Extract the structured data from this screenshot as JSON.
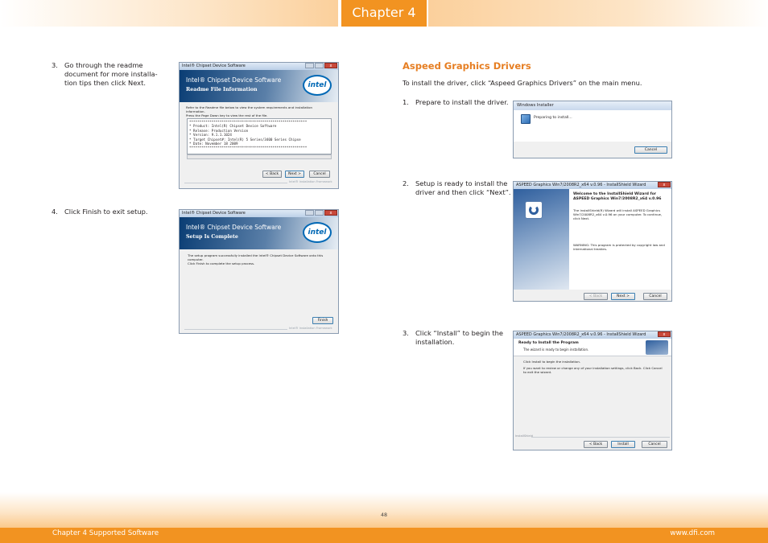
{
  "header": {
    "chapter_tab": "Chapter 4"
  },
  "left": {
    "steps": [
      {
        "num": "3.",
        "text": "Go through the readme document for more installation tips then click Next."
      },
      {
        "num": "4.",
        "text": "Click Finish to exit setup."
      }
    ],
    "step3_lines": [
      "Go through the readme",
      "document for more installa-",
      "tion tips then click Next."
    ],
    "readme_window": {
      "title": "Intel® Chipset Device Software",
      "banner_title": "Intel® Chipset Device Software",
      "banner_sub": "Readme File Information",
      "instruction_1": "Refer to the Readme file below to view the system requirements and installation information.",
      "instruction_2": "Press the Page Down key to view the rest of the file.",
      "readme_lines": [
        "**********************************************************",
        "*  Product: Intel(R) Chipset Device Software",
        "*  Release: Production Version",
        "*  Version: 9.1.1.1024",
        "*  Target Chipset#: Intel(R) 5 Series/3400 Series Chipse",
        "*  Date: November 18 2009",
        "**********************************************************"
      ],
      "btn_back": "< Back",
      "btn_next": "Next >",
      "btn_cancel": "Cancel",
      "footer": "Intel® Installation Framework",
      "close_glyph": "x"
    },
    "complete_window": {
      "title": "Intel® Chipset Device Software",
      "banner_title": "Intel® Chipset Device Software",
      "banner_sub": "Setup Is Complete",
      "message_1": "The setup program successfully installed the Intel® Chipset Device Software onto this computer.",
      "message_2": "Click Finish to complete the setup process.",
      "btn_finish": "Finish",
      "footer": "Intel® Installation Framework",
      "close_glyph": "x"
    },
    "intel_logo": "intel"
  },
  "right": {
    "heading": "Aspeed Graphics Drivers",
    "intro": "To install the driver, click “Aspeed Graphics Drivers” on the main menu.",
    "step1": {
      "num": "1.",
      "text": "Prepare to install the driver."
    },
    "step2": {
      "num": "2.",
      "lines": [
        "Setup is ready to install the",
        "driver and then click “Next”."
      ]
    },
    "step3": {
      "num": "3.",
      "lines": [
        "Click “Install” to begin the",
        "installation."
      ]
    },
    "installer_window": {
      "title": "Windows Installer",
      "message": "Preparing to install...",
      "btn_cancel": "Cancel"
    },
    "wizard_window": {
      "title": "ASPEED Graphics Win7/2008R2_x64 v.0.96 - InstallShield Wizard",
      "welcome_line1": "Welcome to the InstallShield Wizard for",
      "welcome_line2": "ASPEED Graphics Win7/2008R2_x64 v.0.96",
      "desc": "The InstallShield(R) Wizard will install ASPEED Graphics Win7/2008R2_x64 v.0.96 on your computer. To continue, click Next.",
      "warning": "WARNING: This program is protected by copyright law and international treaties.",
      "btn_back": "< Back",
      "btn_next": "Next >",
      "btn_cancel": "Cancel",
      "close_glyph": "x"
    },
    "ready_window": {
      "title": "ASPEED Graphics Win7/2008R2_x64 v.0.96 - InstallShield Wizard",
      "heading": "Ready to Install the Program",
      "subheading": "The wizard is ready to begin installation.",
      "line1": "Click Install to begin the installation.",
      "line2": "If you want to review or change any of your installation settings, click Back. Click Cancel to exit the wizard.",
      "installshield": "InstallShield",
      "btn_back": "< Back",
      "btn_install": "Install",
      "btn_cancel": "Cancel",
      "close_glyph": "x"
    }
  },
  "footer": {
    "page_number": "48",
    "left": "Chapter 4 Supported Software",
    "right": "www.dfi.com"
  }
}
